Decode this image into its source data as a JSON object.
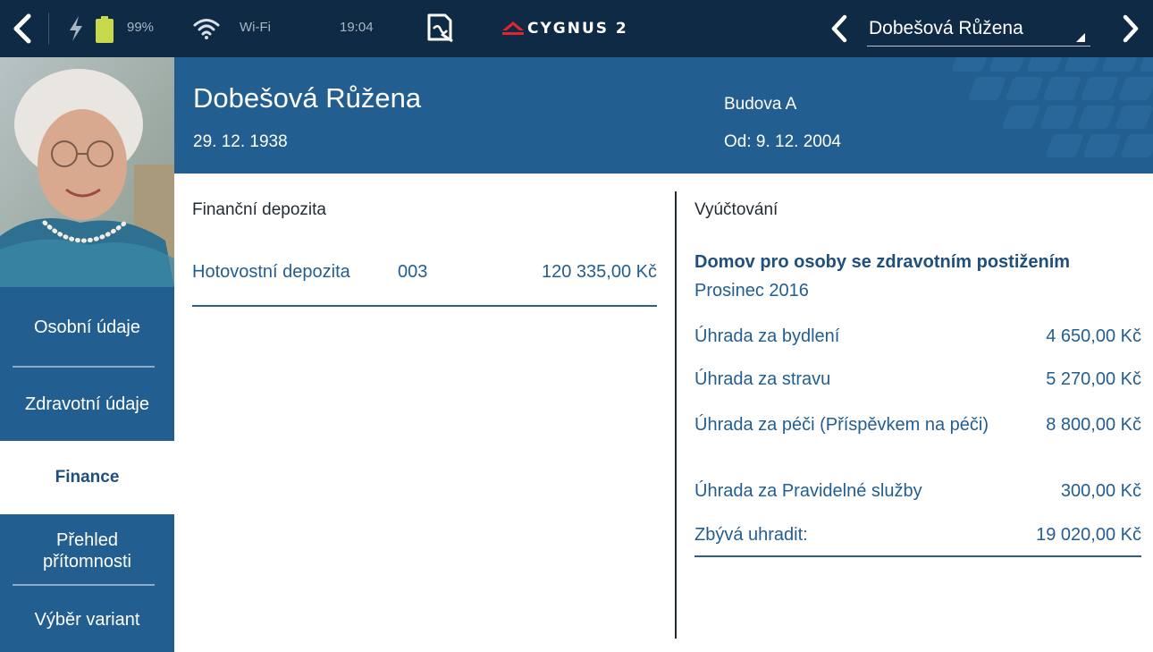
{
  "status_bar": {
    "battery_percent": "99%",
    "wifi_label": "Wi-Fi",
    "time": "19:04",
    "logo_text": "CYGNUS 2",
    "patient_selector": "Dobešová Růžena",
    "icons": [
      "back-arrow-icon",
      "charging-bolt-icon",
      "battery-icon",
      "wifi-icon",
      "document-signature-icon",
      "cygnus-logo",
      "chevron-left-icon",
      "dropdown-triangle-icon",
      "chevron-right-icon"
    ]
  },
  "header": {
    "name": "Dobešová Růžena",
    "birth_date": "29. 12. 1938",
    "building": "Budova A",
    "since": "Od: 9. 12. 2004"
  },
  "sidebar": {
    "items": [
      {
        "label": "Osobní údaje",
        "active": false
      },
      {
        "label": "Zdravotní údaje",
        "active": false
      },
      {
        "label": "Finance",
        "active": true
      },
      {
        "label": "Přehled přítomnosti",
        "active": false
      },
      {
        "label": "Výběr variant",
        "active": false
      }
    ]
  },
  "deposits": {
    "title": "Finanční depozita",
    "rows": [
      {
        "name": "Hotovostní depozita",
        "code": "003",
        "amount": "120 335,00 Kč"
      }
    ]
  },
  "billing": {
    "title": "Vyúčtování",
    "organization": "Domov pro osoby se zdravotním postižením",
    "period": "Prosinec 2016",
    "rows": [
      {
        "label": "Úhrada za bydlení",
        "amount": "4 650,00 Kč"
      },
      {
        "label": "Úhrada za stravu",
        "amount": "5 270,00 Kč"
      },
      {
        "label": "Úhrada za péči (Příspěvkem na péči)",
        "amount": "8 800,00 Kč"
      },
      {
        "label": "Úhrada za Pravidelné služby",
        "amount": "300,00 Kč"
      }
    ],
    "total": {
      "label": "Zbývá uhradit:",
      "amount": "19 020,00 Kč"
    }
  },
  "colors": {
    "topbar": "#0e2a44",
    "header": "#235e91",
    "sidebar": "#235e91",
    "accent_text": "#235e91",
    "battery": "#c7d94a"
  }
}
